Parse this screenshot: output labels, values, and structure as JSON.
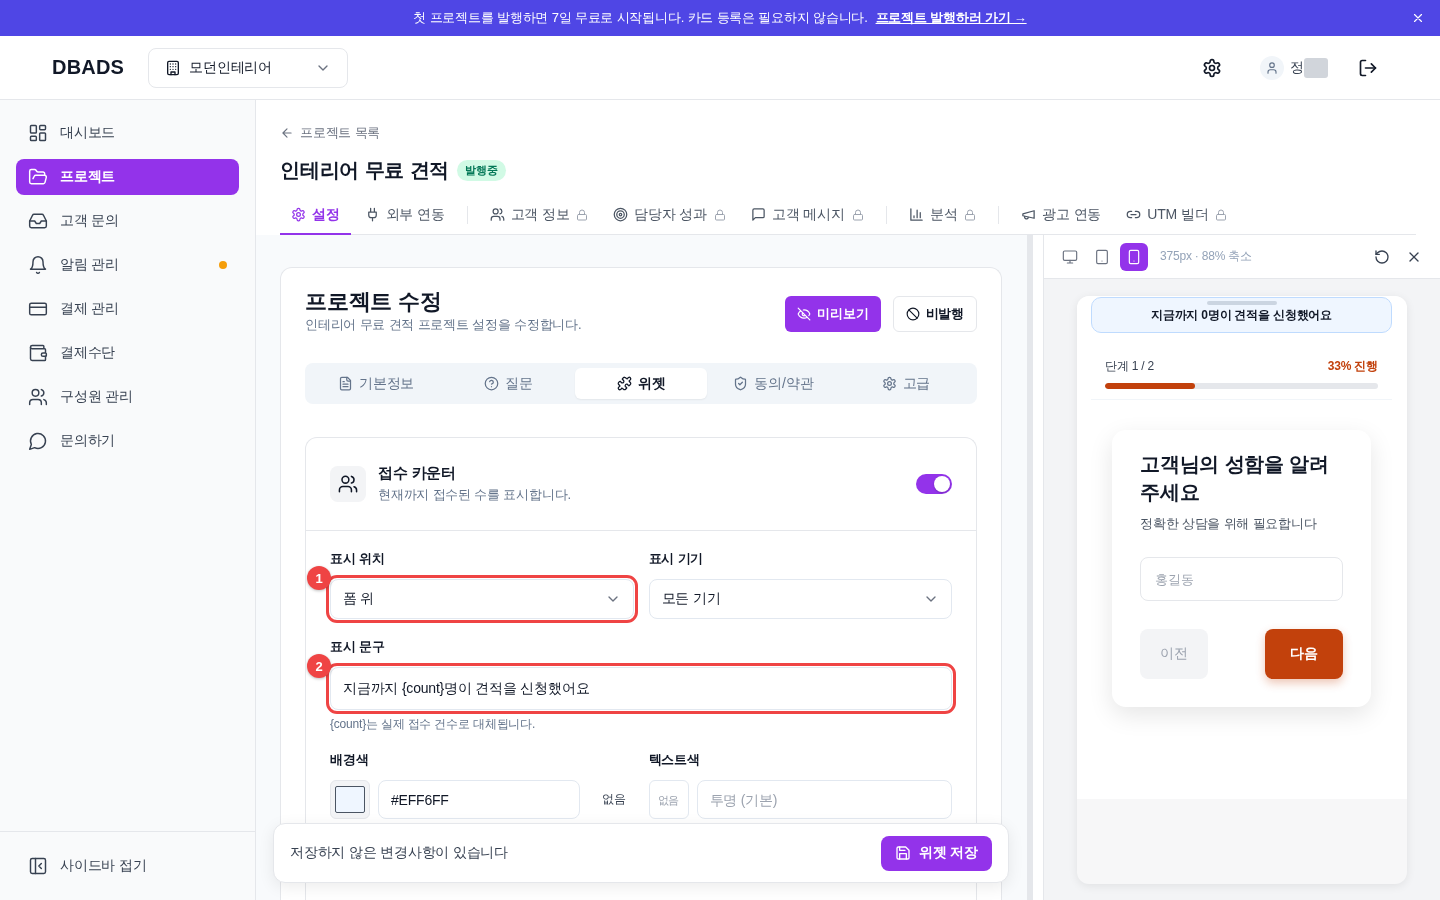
{
  "banner": {
    "message": "첫 프로젝트를 발행하면 7일 무료로 시작됩니다. 카드 등록은 필요하지 않습니다.",
    "link": "프로젝트 발행하러 가기 →"
  },
  "header": {
    "logo": "DBADS",
    "workspace": "모던인테리어",
    "user_name": "정"
  },
  "sidebar": {
    "items": [
      {
        "label": "대시보드",
        "selected": false,
        "alert": false
      },
      {
        "label": "프로젝트",
        "selected": true,
        "alert": false
      },
      {
        "label": "고객 문의",
        "selected": false,
        "alert": false
      },
      {
        "label": "알림 관리",
        "selected": false,
        "alert": true
      },
      {
        "label": "결제 관리",
        "selected": false,
        "alert": false
      },
      {
        "label": "결제수단",
        "selected": false,
        "alert": false
      },
      {
        "label": "구성원 관리",
        "selected": false,
        "alert": false
      },
      {
        "label": "문의하기",
        "selected": false,
        "alert": false
      }
    ],
    "collapse": "사이드바 접기"
  },
  "page": {
    "back_link": "프로젝트 목록",
    "title": "인테리어 무료 견적",
    "status": "발행중"
  },
  "tab_groups": [
    [
      {
        "label": "설정",
        "selected": true,
        "locked": false
      },
      {
        "label": "외부 연동",
        "selected": false,
        "locked": false
      }
    ],
    [
      {
        "label": "고객 정보",
        "selected": false,
        "locked": true
      },
      {
        "label": "담당자 성과",
        "selected": false,
        "locked": true
      },
      {
        "label": "고객 메시지",
        "selected": false,
        "locked": true
      }
    ],
    [
      {
        "label": "분석",
        "selected": false,
        "locked": true
      }
    ],
    [
      {
        "label": "광고 연동",
        "selected": false,
        "locked": false
      },
      {
        "label": "UTM 빌더",
        "selected": false,
        "locked": true
      }
    ]
  ],
  "editor": {
    "title": "프로젝트 수정",
    "subtitle": "인테리어 무료 견적 프로젝트 설정을 수정합니다.",
    "actions": [
      {
        "label": "미리보기",
        "kind": "primary"
      },
      {
        "label": "비발행",
        "kind": "outline"
      }
    ],
    "sections": [
      {
        "label": "기본정보",
        "selected": false
      },
      {
        "label": "질문",
        "selected": false
      },
      {
        "label": "위젯",
        "selected": true
      },
      {
        "label": "동의/약관",
        "selected": false
      },
      {
        "label": "고급",
        "selected": false
      }
    ]
  },
  "widget": {
    "title": "접수 카운터",
    "description": "현재까지 접수된 수를 표시합니다.",
    "enabled": true,
    "position": {
      "label": "표시 위치",
      "value": "폼 위",
      "highlighted": true,
      "marker": "1"
    },
    "device": {
      "label": "표시 기기",
      "value": "모든 기기",
      "highlighted": false
    },
    "message": {
      "label": "표시 문구",
      "value": "지금까지 {count}명이 견적을 신청했어요",
      "help": "{count}는 실제 접수 건수로 대체됩니다.",
      "highlighted": true,
      "marker": "2"
    },
    "background_color": {
      "label": "배경색",
      "color": "#eff6ff",
      "value": "#EFF6FF",
      "clear": "없음"
    },
    "text_color": {
      "label": "텍스트색",
      "swatch_placeholder": "없음",
      "placeholder": "투명 (기본)"
    }
  },
  "save_bar": {
    "message": "저장하지 않은 변경사항이 있습니다",
    "button": "위젯 저장"
  },
  "preview": {
    "devices": [
      {
        "selected": false
      },
      {
        "selected": false
      },
      {
        "selected": true
      }
    ],
    "info": "375px · 88% 축소",
    "counter": "지금까지 0명이 견적을 신청했어요",
    "step": "단계 1 / 2",
    "progress": "33% 진행",
    "level": 0.33,
    "question": "고객님의 성함을 알려주세요",
    "hint": "정확한 상담을 위해 필요합니다",
    "placeholder": "홍길동",
    "buttons": [
      {
        "label": "이전",
        "disabled": true
      },
      {
        "label": "다음",
        "disabled": false
      }
    ]
  }
}
